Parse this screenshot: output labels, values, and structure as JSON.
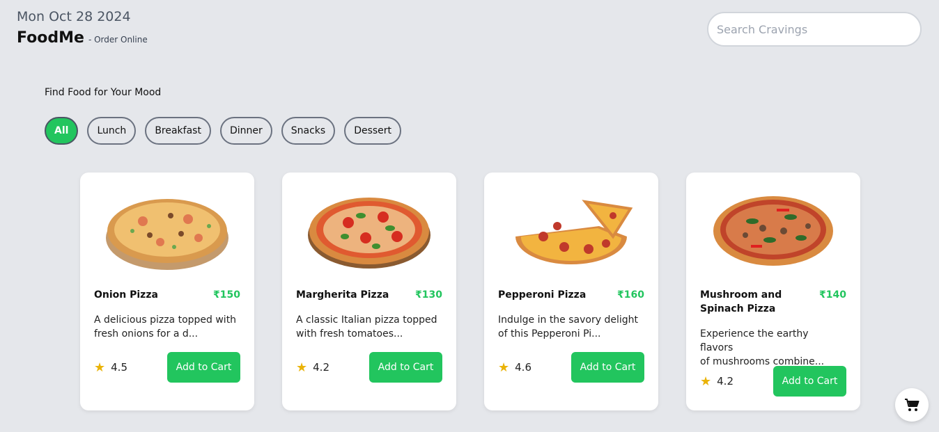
{
  "header": {
    "date": "Mon Oct 28 2024",
    "brand": "FoodMe",
    "tagline": "- Order Online"
  },
  "search": {
    "placeholder": "Search Cravings",
    "value": ""
  },
  "filters": {
    "title": "Find Food for Your Mood",
    "items": [
      "All",
      "Lunch",
      "Breakfast",
      "Dinner",
      "Snacks",
      "Dessert"
    ],
    "active": "All"
  },
  "products": [
    {
      "name": "Onion Pizza",
      "price": "₹150",
      "desc1": "A delicious pizza topped with",
      "desc2": "fresh onions for a d...",
      "rating": "4.5",
      "button": "Add to Cart"
    },
    {
      "name": "Margherita Pizza",
      "price": "₹130",
      "desc1": "A classic Italian pizza topped",
      "desc2": "with fresh tomatoes...",
      "rating": "4.2",
      "button": "Add to Cart"
    },
    {
      "name": "Pepperoni Pizza",
      "price": "₹160",
      "desc1": "Indulge in the savory delight",
      "desc2": "of this Pepperoni Pi...",
      "rating": "4.6",
      "button": "Add to Cart"
    },
    {
      "name": "Mushroom and Spinach Pizza",
      "price": "₹140",
      "desc1": "Experience the earthy flavors",
      "desc2": "of mushrooms combine...",
      "rating": "4.2",
      "button": "Add to Cart"
    }
  ],
  "icons": {
    "rating": "star-icon",
    "cart": "cart-icon"
  },
  "colors": {
    "accent": "#22c55e",
    "star": "#eab308",
    "background": "#e5e7eb"
  }
}
